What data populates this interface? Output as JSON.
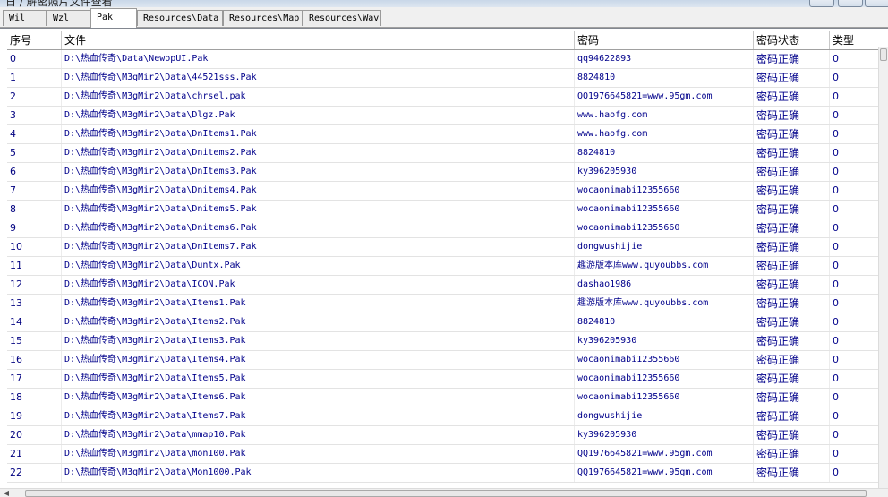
{
  "window": {
    "title": "日 / 解密照片文件查看"
  },
  "tabs": [
    {
      "label": "Wil",
      "active": false
    },
    {
      "label": "Wzl",
      "active": false
    },
    {
      "label": "Pak",
      "active": true
    },
    {
      "label": "Resources\\Data",
      "active": false
    },
    {
      "label": "Resources\\Map",
      "active": false
    },
    {
      "label": "Resources\\Wav",
      "active": false
    }
  ],
  "table": {
    "columns": [
      "序号",
      "文件",
      "密码",
      "密码状态",
      "类型"
    ],
    "rows": [
      [
        "0",
        "D:\\热血传奇\\Data\\NewopUI.Pak",
        "qq94622893",
        "密码正确",
        "0"
      ],
      [
        "1",
        "D:\\热血传奇\\M3gMir2\\Data\\44521sss.Pak",
        "8824810",
        "密码正确",
        "0"
      ],
      [
        "2",
        "D:\\热血传奇\\M3gMir2\\Data\\chrsel.pak",
        "QQ1976645821=www.95gm.com",
        "密码正确",
        "0"
      ],
      [
        "3",
        "D:\\热血传奇\\M3gMir2\\Data\\Dlgz.Pak",
        "www.haofg.com",
        "密码正确",
        "0"
      ],
      [
        "4",
        "D:\\热血传奇\\M3gMir2\\Data\\DnItems1.Pak",
        "www.haofg.com",
        "密码正确",
        "0"
      ],
      [
        "5",
        "D:\\热血传奇\\M3gMir2\\Data\\Dnitems2.Pak",
        "8824810",
        "密码正确",
        "0"
      ],
      [
        "6",
        "D:\\热血传奇\\M3gMir2\\Data\\DnItems3.Pak",
        "ky396205930",
        "密码正确",
        "0"
      ],
      [
        "7",
        "D:\\热血传奇\\M3gMir2\\Data\\Dnitems4.Pak",
        "wocaonimabi12355660",
        "密码正确",
        "0"
      ],
      [
        "8",
        "D:\\热血传奇\\M3gMir2\\Data\\Dnitems5.Pak",
        "wocaonimabi12355660",
        "密码正确",
        "0"
      ],
      [
        "9",
        "D:\\热血传奇\\M3gMir2\\Data\\Dnitems6.Pak",
        "wocaonimabi12355660",
        "密码正确",
        "0"
      ],
      [
        "10",
        "D:\\热血传奇\\M3gMir2\\Data\\DnItems7.Pak",
        "dongwushijie",
        "密码正确",
        "0"
      ],
      [
        "11",
        "D:\\热血传奇\\M3gMir2\\Data\\Duntx.Pak",
        "趣游版本库www.quyoubbs.com",
        "密码正确",
        "0"
      ],
      [
        "12",
        "D:\\热血传奇\\M3gMir2\\Data\\ICON.Pak",
        "dashao1986",
        "密码正确",
        "0"
      ],
      [
        "13",
        "D:\\热血传奇\\M3gMir2\\Data\\Items1.Pak",
        "趣游版本库www.quyoubbs.com",
        "密码正确",
        "0"
      ],
      [
        "14",
        "D:\\热血传奇\\M3gMir2\\Data\\Items2.Pak",
        "8824810",
        "密码正确",
        "0"
      ],
      [
        "15",
        "D:\\热血传奇\\M3gMir2\\Data\\Items3.Pak",
        "ky396205930",
        "密码正确",
        "0"
      ],
      [
        "16",
        "D:\\热血传奇\\M3gMir2\\Data\\Items4.Pak",
        "wocaonimabi12355660",
        "密码正确",
        "0"
      ],
      [
        "17",
        "D:\\热血传奇\\M3gMir2\\Data\\Items5.Pak",
        "wocaonimabi12355660",
        "密码正确",
        "0"
      ],
      [
        "18",
        "D:\\热血传奇\\M3gMir2\\Data\\Items6.Pak",
        "wocaonimabi12355660",
        "密码正确",
        "0"
      ],
      [
        "19",
        "D:\\热血传奇\\M3gMir2\\Data\\Items7.Pak",
        "dongwushijie",
        "密码正确",
        "0"
      ],
      [
        "20",
        "D:\\热血传奇\\M3gMir2\\Data\\mmap10.Pak",
        "ky396205930",
        "密码正确",
        "0"
      ],
      [
        "21",
        "D:\\热血传奇\\M3gMir2\\Data\\mon100.Pak",
        "QQ1976645821=www.95gm.com",
        "密码正确",
        "0"
      ],
      [
        "22",
        "D:\\热血传奇\\M3gMir2\\Data\\Mon1000.Pak",
        "QQ1976645821=www.95gm.com",
        "密码正确",
        "0"
      ]
    ]
  },
  "colors": {
    "cell_text": "#00008b",
    "index_text": "#000080",
    "grid_line": "#e3e3e3"
  }
}
